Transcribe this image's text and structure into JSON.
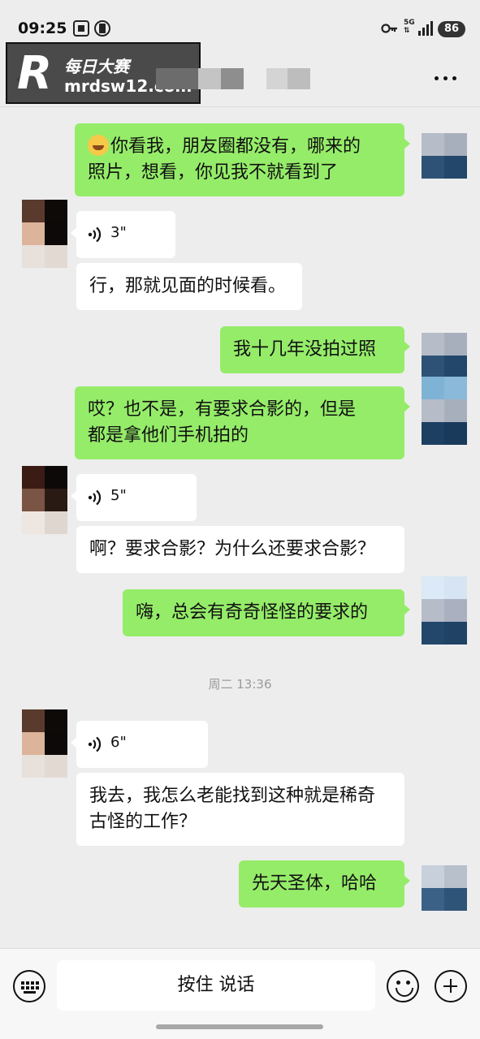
{
  "status_bar": {
    "time": "09:25",
    "network": "5G",
    "battery": "86"
  },
  "header": {
    "watermark": {
      "logo_letter": "R",
      "site_name": "每日大赛",
      "url": "mrdsw12.com"
    },
    "more_icon": "more-icon",
    "back_icon": "chevron-left-icon"
  },
  "messages": [
    {
      "side": "out",
      "type": "text",
      "emoji": "rolling-laughing-emoji",
      "lines": [
        "你看我，朋友圈都没有，哪来的",
        "照片，想看，你见我不就看到了"
      ]
    },
    {
      "side": "in",
      "type": "voice",
      "duration": "3\""
    },
    {
      "side": "in",
      "type": "text",
      "lines": [
        "行，那就见面的时候看。"
      ]
    },
    {
      "side": "out",
      "type": "text",
      "lines": [
        "我十几年没拍过照"
      ]
    },
    {
      "side": "out",
      "type": "text",
      "lines": [
        "哎？也不是，有要求合影的，但是",
        "都是拿他们手机拍的"
      ]
    },
    {
      "side": "in",
      "type": "voice",
      "duration": "5\""
    },
    {
      "side": "in",
      "type": "text",
      "lines": [
        "啊？要求合影？为什么还要求合影？"
      ]
    },
    {
      "side": "out",
      "type": "text",
      "lines": [
        "嗨，总会有奇奇怪怪的要求的"
      ]
    },
    {
      "side": "system",
      "type": "timestamp",
      "text": "周二 13:36"
    },
    {
      "side": "in",
      "type": "voice",
      "duration": "6\""
    },
    {
      "side": "in",
      "type": "text",
      "lines": [
        "我去，我怎么老能找到这种就是稀奇",
        "古怪的工作？"
      ]
    },
    {
      "side": "out",
      "type": "text",
      "lines": [
        "先天圣体，哈哈"
      ]
    }
  ],
  "input_bar": {
    "keyboard_icon": "keyboard-icon",
    "hold_to_talk": "按住 说话",
    "emoji_icon": "emoji-icon",
    "plus_icon": "plus-icon"
  },
  "colors": {
    "outgoing_bubble": "#95ec69",
    "incoming_bubble": "#ffffff",
    "background": "#ededed"
  }
}
